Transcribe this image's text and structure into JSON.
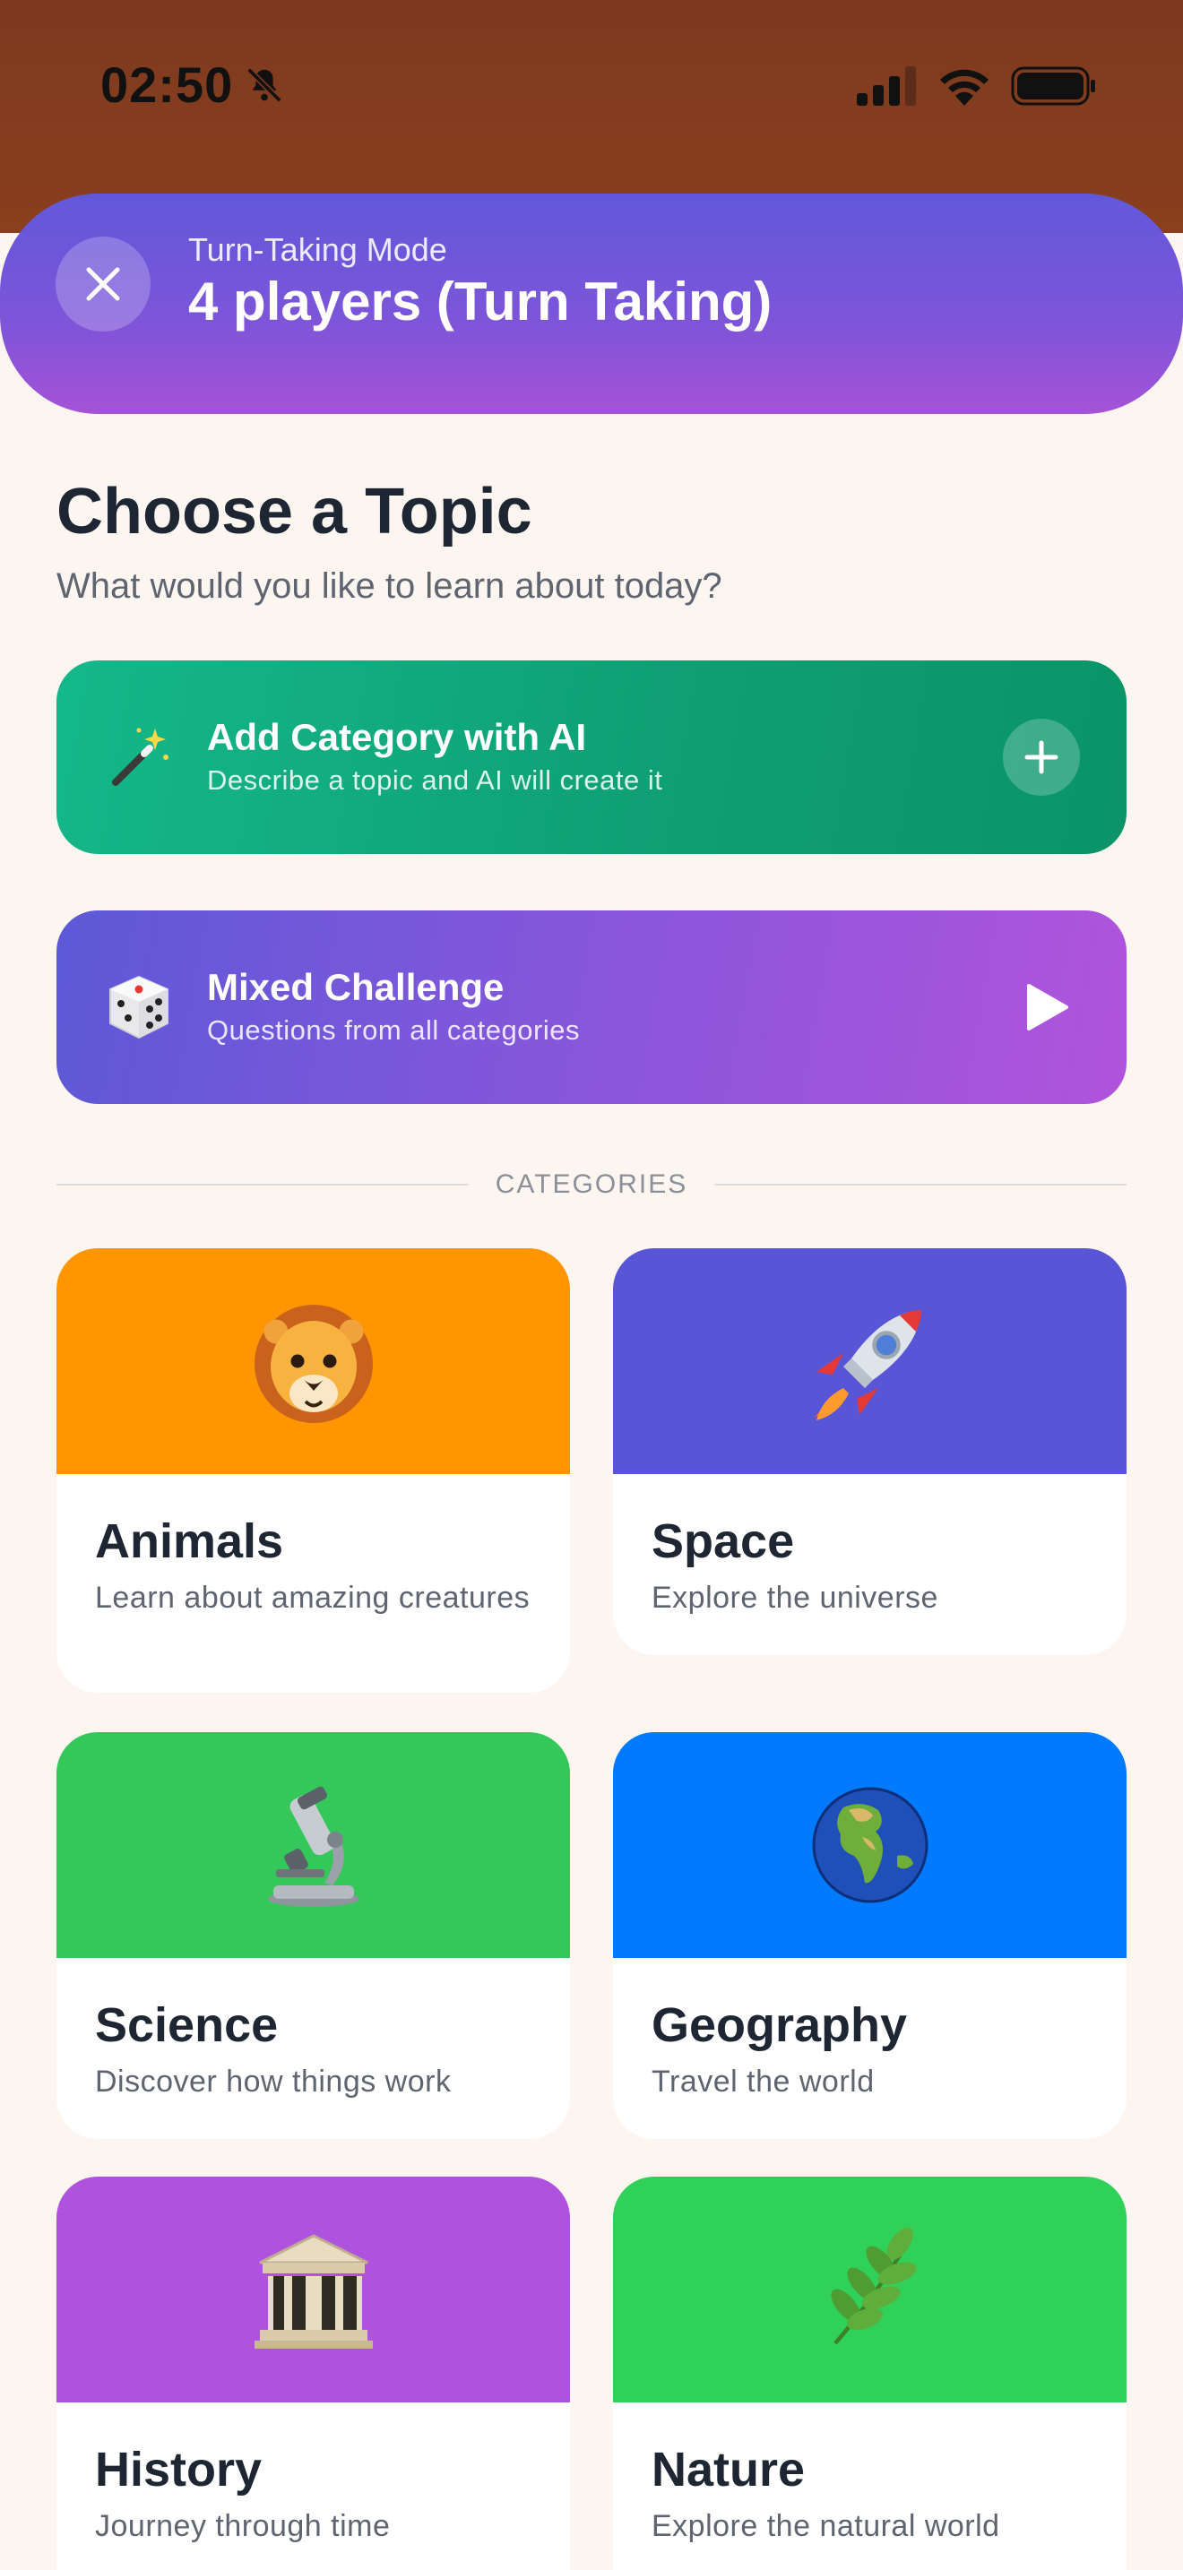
{
  "status_bar": {
    "time": "02:50",
    "icons": [
      "bell-slash-icon",
      "cellular-signal-icon",
      "wifi-icon",
      "battery-icon"
    ]
  },
  "mode_banner": {
    "subtitle": "Turn-Taking Mode",
    "title": "4 players (Turn Taking)",
    "close_icon": "close-icon"
  },
  "header": {
    "title": "Choose a Topic",
    "subtitle": "What would you like to learn about today?"
  },
  "ai_card": {
    "icon": "magic-wand-icon",
    "title": "Add Category with AI",
    "subtitle": "Describe a topic and AI will create it",
    "action_icon": "plus-icon"
  },
  "mixed_card": {
    "icon": "dice-icon",
    "title": "Mixed Challenge",
    "subtitle": "Questions from all categories",
    "action_icon": "play-icon"
  },
  "categories_label": "CATEGORIES",
  "categories": [
    {
      "name": "Animals",
      "description": "Learn about amazing creatures",
      "icon": "lion-icon",
      "color": "#ff9500"
    },
    {
      "name": "Space",
      "description": "Explore the universe",
      "icon": "rocket-icon",
      "color": "#5856d6"
    },
    {
      "name": "Science",
      "description": "Discover how things work",
      "icon": "microscope-icon",
      "color": "#34c759"
    },
    {
      "name": "Geography",
      "description": "Travel the world",
      "icon": "globe-icon",
      "color": "#007aff"
    },
    {
      "name": "History",
      "description": "Journey through time",
      "icon": "classical-building-icon",
      "color": "#af52de"
    },
    {
      "name": "Nature",
      "description": "Explore the natural world",
      "icon": "herb-icon",
      "color": "#30d158"
    }
  ],
  "colors": {
    "background": "#fdf6f0",
    "status_bar": "#7d3a1f",
    "ai_card": "#10a67a",
    "mixed_card_start": "#5d59d8",
    "mixed_card_end": "#b153dc"
  }
}
